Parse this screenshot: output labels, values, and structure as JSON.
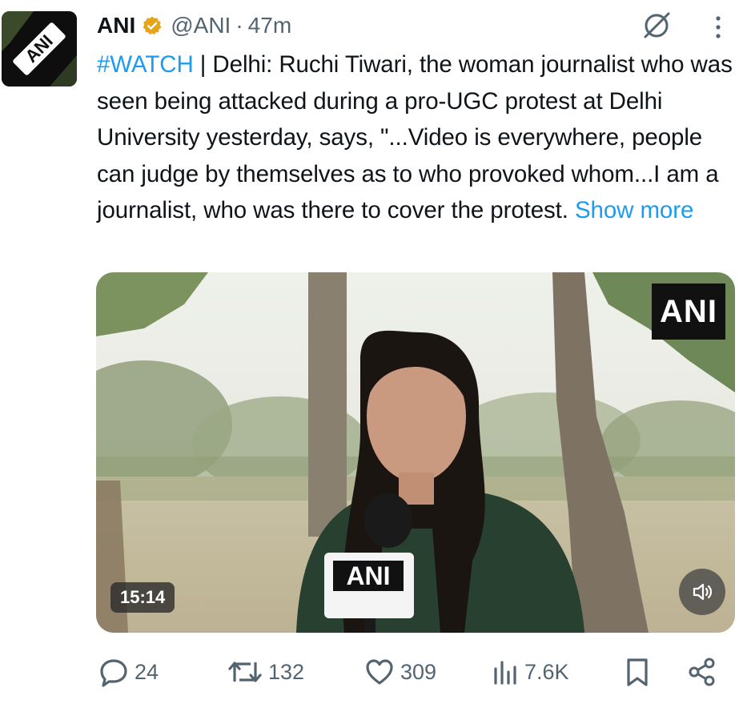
{
  "tweet": {
    "author_name": "ANI",
    "handle": "@ANI",
    "separator": "·",
    "time_ago": "47m",
    "avatar_text": "ANI",
    "hashtag": "#WATCH",
    "body": " | Delhi: Ruchi Tiwari, the woman journalist who was seen being attacked during a pro-UGC protest at Delhi University yesterday, says, \"...Video is everywhere, people can judge by themselves as to who provoked whom...I am a journalist, who was there to cover the protest. ",
    "show_more": "Show more"
  },
  "media": {
    "watermark": "ANI",
    "mic_label": "ANI",
    "duration": "15:14"
  },
  "actions": {
    "replies": "24",
    "reposts": "132",
    "likes": "309",
    "views": "7.6K"
  },
  "colors": {
    "accent": "#1d9bf0",
    "secondary_text": "#536471",
    "verified_badge": "#e8a317"
  },
  "icons": [
    "verified-badge-icon",
    "grok-icon",
    "more-icon",
    "volume-icon",
    "reply-icon",
    "repost-icon",
    "like-icon",
    "views-icon",
    "bookmark-icon",
    "share-icon"
  ]
}
